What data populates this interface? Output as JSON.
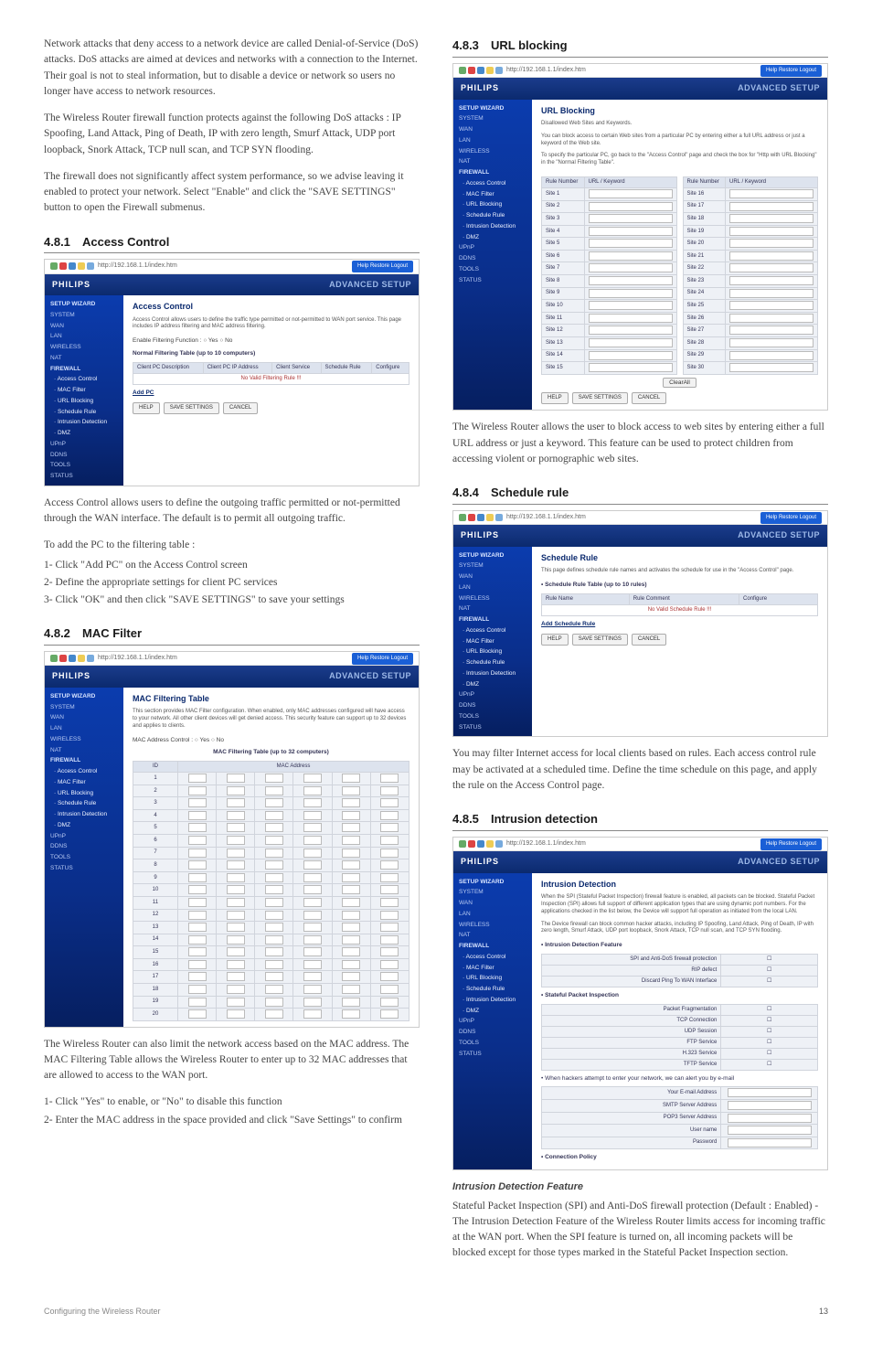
{
  "left": {
    "intro1": "Network attacks that deny access to a network device are called Denial-of-Service (DoS) attacks. DoS attacks are aimed at devices and networks with a connection to the Internet. Their goal is not to steal information, but to disable a device or network so users no longer have access to network resources.",
    "intro2": "The Wireless Router firewall function protects against the following DoS attacks : IP Spoofing, Land Attack, Ping of Death, IP with zero length, Smurf Attack, UDP port loopback, Snork Attack, TCP null scan, and TCP SYN flooding.",
    "intro3": "The firewall does not significantly affect system performance, so we advise leaving it enabled to protect your network. Select \"Enable\" and click the \"SAVE SETTINGS\" button to open the Firewall submenus.",
    "s481": {
      "num": "4.8.1",
      "title": "Access Control"
    },
    "acDesc": "Access Control allows users to define the outgoing traffic permitted or not-permitted through the WAN interface. The default is to permit all outgoing traffic.",
    "acIntro": "To add the PC to the filtering table :",
    "acSteps": [
      "1- Click \"Add PC\" on the Access Control screen",
      "2- Define the appropriate settings for client PC services",
      "3- Click \"OK\" and then click \"SAVE SETTINGS\" to save your settings"
    ],
    "s482": {
      "num": "4.8.2",
      "title": "MAC Filter"
    },
    "macDesc": "The Wireless Router can also limit the network access based on the MAC address. The MAC Filtering Table allows the Wireless Router to enter up to 32 MAC addresses that are  allowed to access to the WAN port.",
    "macSteps": [
      "1- Click \"Yes\" to enable, or \"No\" to disable this function",
      "2- Enter the MAC address in the space provided and click \"Save Settings\" to confirm"
    ]
  },
  "right": {
    "s483": {
      "num": "4.8.3",
      "title": "URL blocking"
    },
    "urlDesc": "The Wireless Router allows the user to block access to web sites by entering either a full URL address or just a keyword. This feature can be used to protect children from accessing violent or pornographic web sites.",
    "s484": {
      "num": "4.8.4",
      "title": "Schedule rule"
    },
    "schedDesc": "You may filter Internet access for local clients based on rules. Each access control rule may be activated at a scheduled time. Define the time schedule on this page, and apply the rule on the Access Control page.",
    "s485": {
      "num": "4.8.5",
      "title": "Intrusion detection"
    },
    "idfHead": "Intrusion Detection Feature",
    "idfDesc": "Stateful Packet Inspection (SPI) and Anti-DoS firewall protection (Default : Enabled) - The Intrusion Detection Feature of the Wireless Router limits access for incoming traffic at the WAN port.  When the SPI feature is turned on, all incoming packets will be blocked except for those types marked in the Stateful Packet Inspection section."
  },
  "ui": {
    "brand": "PHILIPS",
    "advanced": "ADVANCED SETUP",
    "helpbar": "Help  Restore  Logout",
    "addrbar": "http://192.168.1.1/index.htm",
    "nav": {
      "items": [
        "SETUP WIZARD",
        "SYSTEM",
        "WAN",
        "LAN",
        "WIRELESS",
        "NAT",
        "FIREWALL",
        "UPnP",
        "DDNS",
        "TOOLS",
        "STATUS"
      ],
      "fw_sub": [
        "· Access Control",
        "· MAC Filter",
        "· URL Blocking",
        "· Schedule Rule",
        "· Intrusion Detection",
        "· DMZ"
      ]
    },
    "buttons": {
      "help": "HELP",
      "save": "SAVE SETTINGS",
      "cancel": "CANCEL",
      "clearall": "ClearAll",
      "addpc": "Add PC",
      "configure": "Configure"
    },
    "ac": {
      "title": "Access Control",
      "desc": "Access Control allows users to define the traffic type permitted or not-permitted to WAN port service. This page includes IP address filtering and MAC address filtering.",
      "enable": "Enable Filtering Function :   ○ Yes   ○ No",
      "sub": "Normal Filtering Table (up to 10 computers)",
      "th1": "Client PC Description",
      "th2": "Client PC IP Address",
      "th3": "Client Service",
      "th4": "Schedule Rule",
      "th5": "Configure",
      "norule": "No Valid Filtering Rule !!!"
    },
    "mac": {
      "title": "MAC Filtering Table",
      "desc": "This section provides MAC Filter configuration. When enabled, only MAC addresses configured will have access to your network. All other client devices will get denied access. This security feature can support up to 32 devices and applies to clients.",
      "ctrl": "MAC Address Control :   ○ Yes   ○ No",
      "sub": "MAC Filtering Table (up to 32 computers)",
      "th1": "ID",
      "th2": "MAC Address",
      "ids": [
        "1",
        "2",
        "3",
        "4",
        "5",
        "6",
        "7",
        "8",
        "9",
        "10",
        "11",
        "12",
        "13",
        "14",
        "15",
        "16",
        "17",
        "18",
        "19",
        "20"
      ]
    },
    "url": {
      "title": "URL Blocking",
      "desc1": "Disallowed Web Sites and Keywords.",
      "desc2": "You can block access to certain Web sites from a particular PC by entering either a full URL address or just a keyword of the Web site.",
      "desc3": "To specify the particular PC, go back to the \"Access Control\" page and check the box for \"Http with URL Blocking\" in the \"Normal Filtering Table\".",
      "th1": "Rule Number",
      "th2": "URL / Keyword",
      "sitesL": [
        "Site 1",
        "Site 2",
        "Site 3",
        "Site 4",
        "Site 5",
        "Site 6",
        "Site 7",
        "Site 8",
        "Site 9",
        "Site 10",
        "Site 11",
        "Site 12",
        "Site 13",
        "Site 14",
        "Site 15"
      ],
      "sitesR": [
        "Site 16",
        "Site 17",
        "Site 18",
        "Site 19",
        "Site 20",
        "Site 21",
        "Site 22",
        "Site 23",
        "Site 24",
        "Site 25",
        "Site 26",
        "Site 27",
        "Site 28",
        "Site 29",
        "Site 30"
      ]
    },
    "sched": {
      "title": "Schedule Rule",
      "desc": "This page defines schedule rule names and activates the schedule for use in the \"Access Control\" page.",
      "sub": "• Schedule Rule Table (up to 10 rules)",
      "th1": "Rule Name",
      "th2": "Rule Comment",
      "th3": "Configure",
      "norule": "No Valid Schedule Rule !!!",
      "add": "Add Schedule Rule"
    },
    "intr": {
      "title": "Intrusion Detection",
      "desc1": "When the SPI (Stateful Packet Inspection) firewall feature is enabled, all packets can be blocked. Stateful Packet Inspection (SPI) allows full support of different application types that are using dynamic port numbers. For the applications checked in the list below, the Device will support full operation as initiated from the local LAN.",
      "desc2": "The Device firewall can block common hacker attacks, including IP Spoofing, Land Attack, Ping of Death, IP with zero length, Smurf Attack, UDP port loopback, Snork Attack, TCP null scan, and TCP SYN flooding.",
      "s1": "• Intrusion Detection Feature",
      "rows1": [
        "SPI and Anti-DoS firewall protection",
        "RIP defect",
        "Discard Ping To WAN Interface"
      ],
      "s2": "• Stateful Packet Inspection",
      "rows2": [
        "Packet Fragmentation",
        "TCP Connection",
        "UDP Session",
        "FTP Service",
        "H.323 Service",
        "TFTP Service"
      ],
      "s3": "• When hackers attempt to enter your network, we can alert you by e-mail",
      "rows3": [
        "Your E-mail Address",
        "SMTP Server Address",
        "POP3 Server Address",
        "User name",
        "Password"
      ],
      "s4": "• Connection Policy"
    }
  },
  "footer": {
    "left": "Configuring the Wireless Router",
    "right": "13"
  }
}
